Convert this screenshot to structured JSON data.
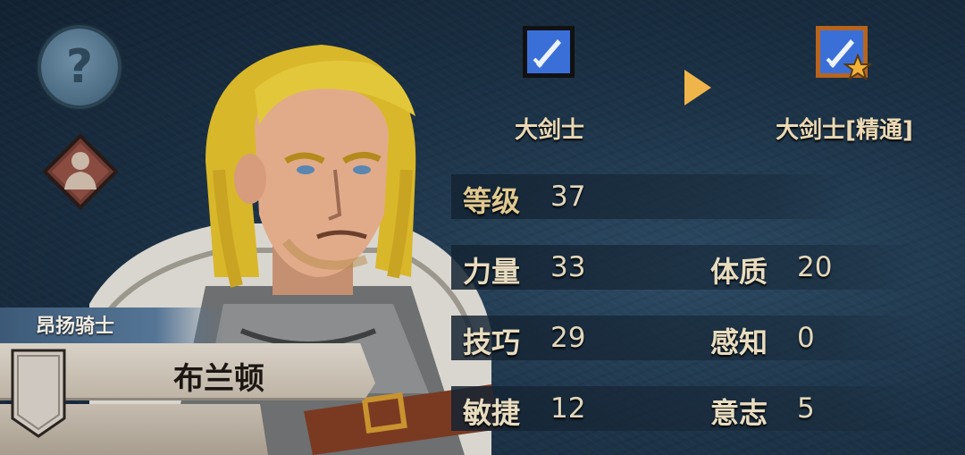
{
  "character": {
    "title": "昂扬骑士",
    "name": "布兰顿"
  },
  "class_change": {
    "from_class": "大剑士",
    "to_class": "大剑士[精通]",
    "from_icon": "sword-icon",
    "to_icon": "sword-star-icon"
  },
  "stats": {
    "level": {
      "label": "等级",
      "value": "37"
    },
    "strength": {
      "label": "力量",
      "value": "33"
    },
    "constitution": {
      "label": "体质",
      "value": "20"
    },
    "skill": {
      "label": "技巧",
      "value": "29"
    },
    "perception": {
      "label": "感知",
      "value": "0"
    },
    "agility": {
      "label": "敏捷",
      "value": "12"
    },
    "will": {
      "label": "意志",
      "value": "5"
    }
  },
  "buttons": {
    "help_icon": "question-icon",
    "profile_icon": "portrait-icon"
  },
  "colors": {
    "accent": "#f0b54a",
    "text": "#e8dcc0",
    "plate": "#d8d1c6"
  }
}
